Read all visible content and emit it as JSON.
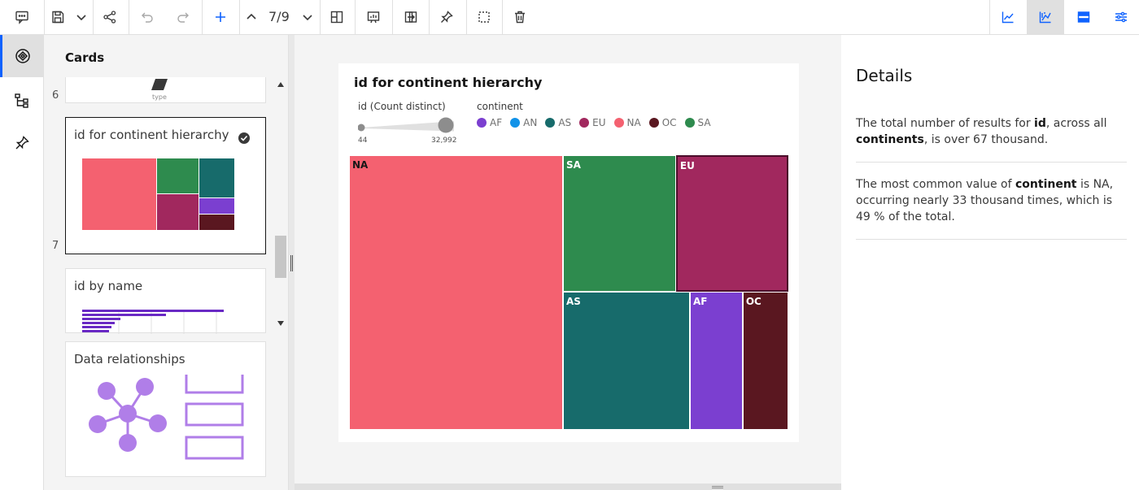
{
  "toolbar": {
    "page_indicator": "7/9"
  },
  "cards_panel": {
    "title": "Cards",
    "cards": [
      {
        "number": "6",
        "caption": "type"
      },
      {
        "number": "7",
        "title": "id for continent hierarchy"
      },
      {
        "title": "id by name"
      },
      {
        "title": "Data relationships"
      }
    ]
  },
  "visualization": {
    "title": "id for continent hierarchy",
    "size_legend": {
      "label": "id (Count distinct)",
      "min": "44",
      "max": "32,992"
    },
    "color_legend": {
      "label": "continent",
      "items": [
        {
          "name": "AF",
          "color": "#7b3fd0"
        },
        {
          "name": "AN",
          "color": "#1192e8"
        },
        {
          "name": "AS",
          "color": "#176b6b"
        },
        {
          "name": "EU",
          "color": "#a1285e"
        },
        {
          "name": "NA",
          "color": "#f46170"
        },
        {
          "name": "OC",
          "color": "#5a1720"
        },
        {
          "name": "SA",
          "color": "#2e8b4e"
        }
      ]
    }
  },
  "chart_data": {
    "type": "treemap",
    "title": "id for continent hierarchy",
    "size_measure": "id (Count distinct)",
    "color_field": "continent",
    "nodes": [
      {
        "label": "NA",
        "value": 32992,
        "color": "#f46170"
      },
      {
        "label": "SA",
        "value": 8650,
        "color": "#2e8b4e"
      },
      {
        "label": "EU",
        "value": 8600,
        "color": "#a1285e"
      },
      {
        "label": "AS",
        "value": 9860,
        "color": "#176b6b"
      },
      {
        "label": "AF",
        "value": 4100,
        "color": "#7b3fd0"
      },
      {
        "label": "OC",
        "value": 3550,
        "color": "#5a1720"
      },
      {
        "label": "AN",
        "value": 44,
        "color": "#1192e8"
      }
    ],
    "selected": "EU"
  },
  "details": {
    "title": "Details",
    "insight1": {
      "p1": "The total number of results for ",
      "b1": "id",
      "p2": ", across all ",
      "b2": "continents",
      "p3": ", is over 67 thousand."
    },
    "insight2": {
      "p1": "The most common value of ",
      "b1": "continent",
      "p2": " is NA, occurring nearly 33 thousand times, which is 49 % of the total."
    }
  }
}
